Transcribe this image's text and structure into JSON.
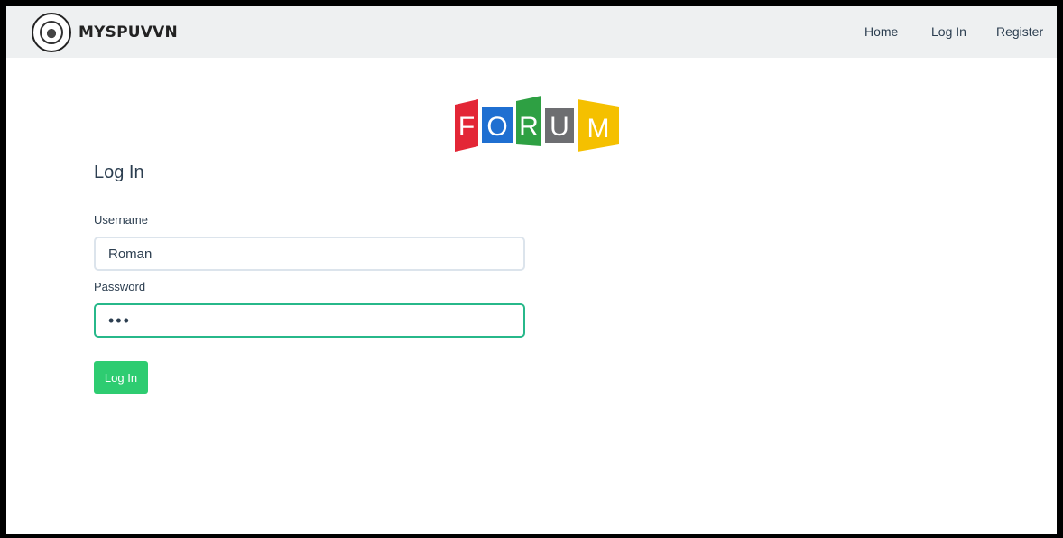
{
  "navbar": {
    "brand": "MYSPUVVN",
    "links": [
      "Home",
      "Log In",
      "Register"
    ]
  },
  "logo": {
    "letters": [
      "F",
      "O",
      "R",
      "U",
      "M"
    ],
    "colors": [
      "#e32636",
      "#1f6fd1",
      "#2ea043",
      "#6d6e71",
      "#f5c000"
    ]
  },
  "form": {
    "title": "Log In",
    "username_label": "Username",
    "username_value": "Roman",
    "password_label": "Password",
    "password_value": "•••",
    "submit_label": "Log In"
  },
  "colors": {
    "accent": "#2ecc71",
    "focus_border": "#27b88a",
    "text": "#2c3e50"
  }
}
